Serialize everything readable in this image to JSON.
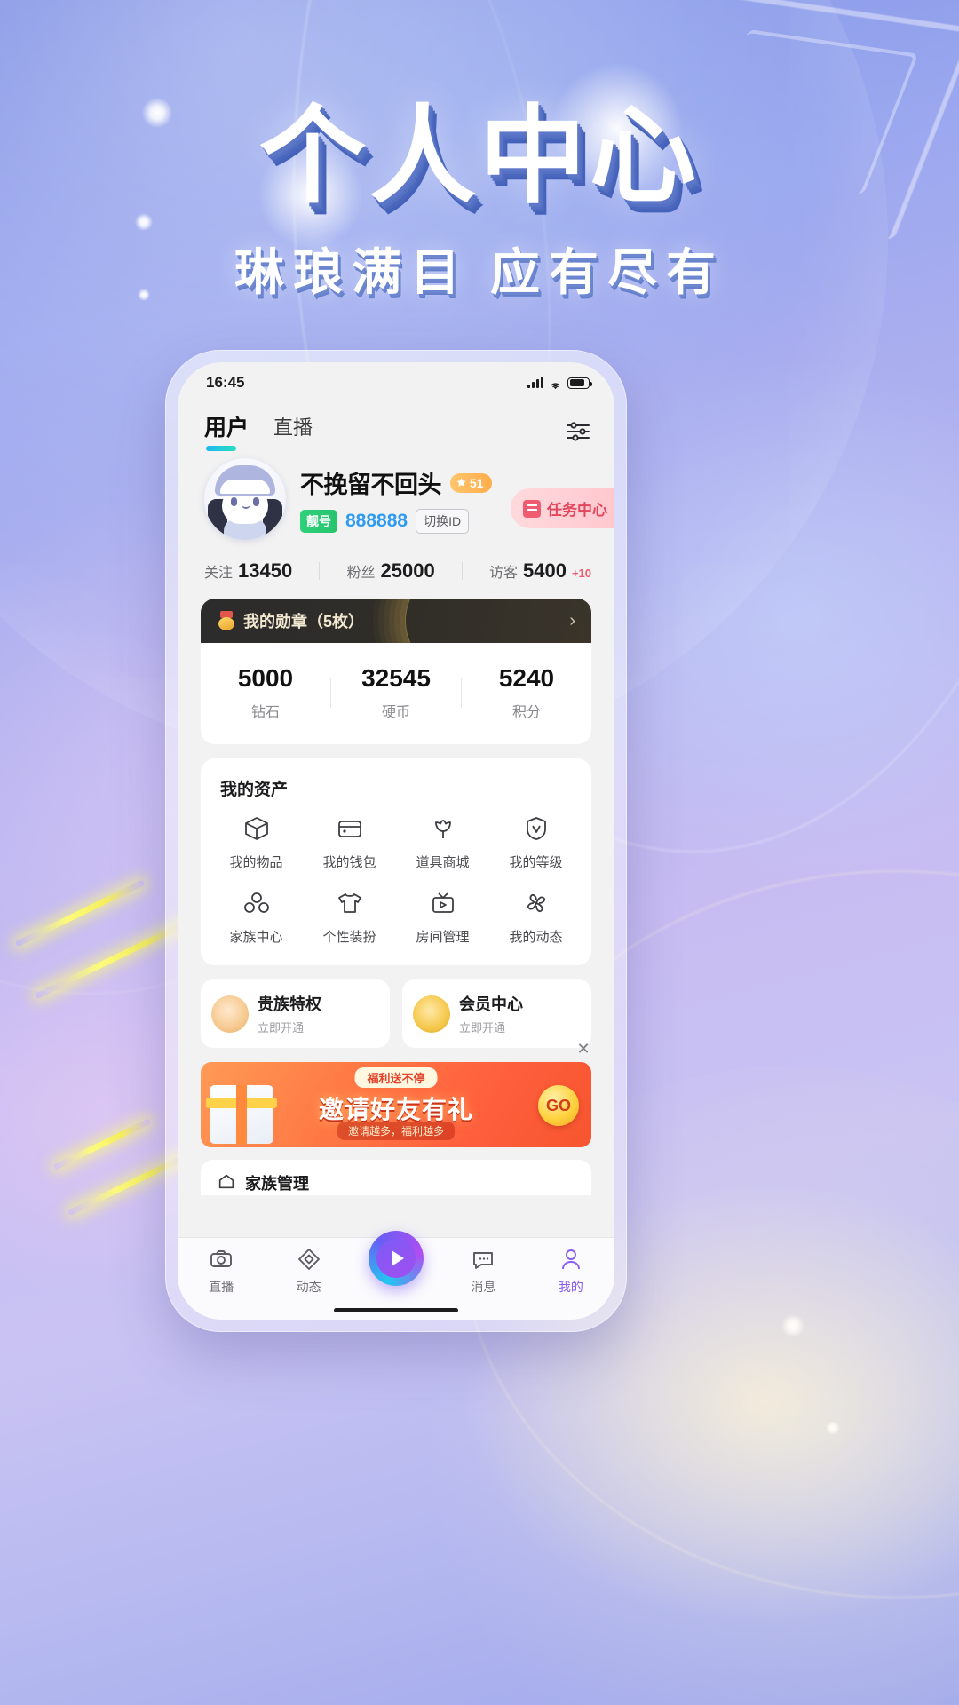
{
  "poster": {
    "headline": "个人中心",
    "subhead": "琳琅满目 应有尽有"
  },
  "statusbar": {
    "time": "16:45",
    "signal_icon": "signal-bars-icon",
    "wifi_icon": "wifi-icon",
    "battery_icon": "battery-icon"
  },
  "tabs": {
    "items": [
      {
        "label": "用户",
        "active": true
      },
      {
        "label": "直播",
        "active": false
      }
    ],
    "filter_icon": "filter-sliders-icon",
    "active_underline_color": "#20b6f0"
  },
  "profile": {
    "avatar_icon": "user-avatar",
    "username": "不挽留不回头",
    "level_badge": {
      "icon": "crown-star-icon",
      "value": "51",
      "color": "#ffad4d"
    },
    "id_tag": "靓号",
    "id_number": "888888",
    "switch_id_label": "切换ID",
    "task_center": {
      "label": "任务中心",
      "icon": "task-icon",
      "color": "#e2455c"
    }
  },
  "stats": [
    {
      "label": "关注",
      "value": "13450",
      "delta": ""
    },
    {
      "label": "粉丝",
      "value": "25000",
      "delta": ""
    },
    {
      "label": "访客",
      "value": "5400",
      "delta": "+10"
    }
  ],
  "medal": {
    "icon": "medal-icon",
    "title": "我的勋章（5枚）",
    "chevron": "›"
  },
  "wallet": [
    {
      "value": "5000",
      "label": "钻石"
    },
    {
      "value": "32545",
      "label": "硬币"
    },
    {
      "value": "5240",
      "label": "积分"
    }
  ],
  "assets": {
    "title": "我的资产",
    "items": [
      {
        "label": "我的物品",
        "icon": "box-icon"
      },
      {
        "label": "我的钱包",
        "icon": "wallet-icon"
      },
      {
        "label": "道具商城",
        "icon": "tulip-icon"
      },
      {
        "label": "我的等级",
        "icon": "shield-v-icon"
      },
      {
        "label": "家族中心",
        "icon": "family-icon"
      },
      {
        "label": "个性装扮",
        "icon": "tshirt-icon"
      },
      {
        "label": "房间管理",
        "icon": "tv-icon"
      },
      {
        "label": "我的动态",
        "icon": "flower-icon"
      }
    ]
  },
  "privileges": [
    {
      "title": "贵族特权",
      "subtitle": "立即开通",
      "icon": "noble-icon"
    },
    {
      "title": "会员中心",
      "subtitle": "立即开通",
      "icon": "vip-coin-icon"
    }
  ],
  "banner": {
    "top_label": "福利送不停",
    "main_text": "邀请好友有礼",
    "sub_text": "邀请越多，福利越多",
    "cta": "GO",
    "close_icon": "close-icon",
    "gift_icon": "gift-box-icon"
  },
  "clipped_card": {
    "label": "家族管理",
    "icon": "house-icon"
  },
  "tabbar": {
    "items": [
      {
        "label": "直播",
        "icon": "camera-icon",
        "active": false
      },
      {
        "label": "动态",
        "icon": "diamond-icon",
        "active": false
      },
      {
        "label": "",
        "icon": "play-center-button",
        "active": false,
        "center": true
      },
      {
        "label": "消息",
        "icon": "chat-icon",
        "active": false
      },
      {
        "label": "我的",
        "icon": "person-icon",
        "active": true
      }
    ],
    "active_color": "#8a5cf0"
  }
}
